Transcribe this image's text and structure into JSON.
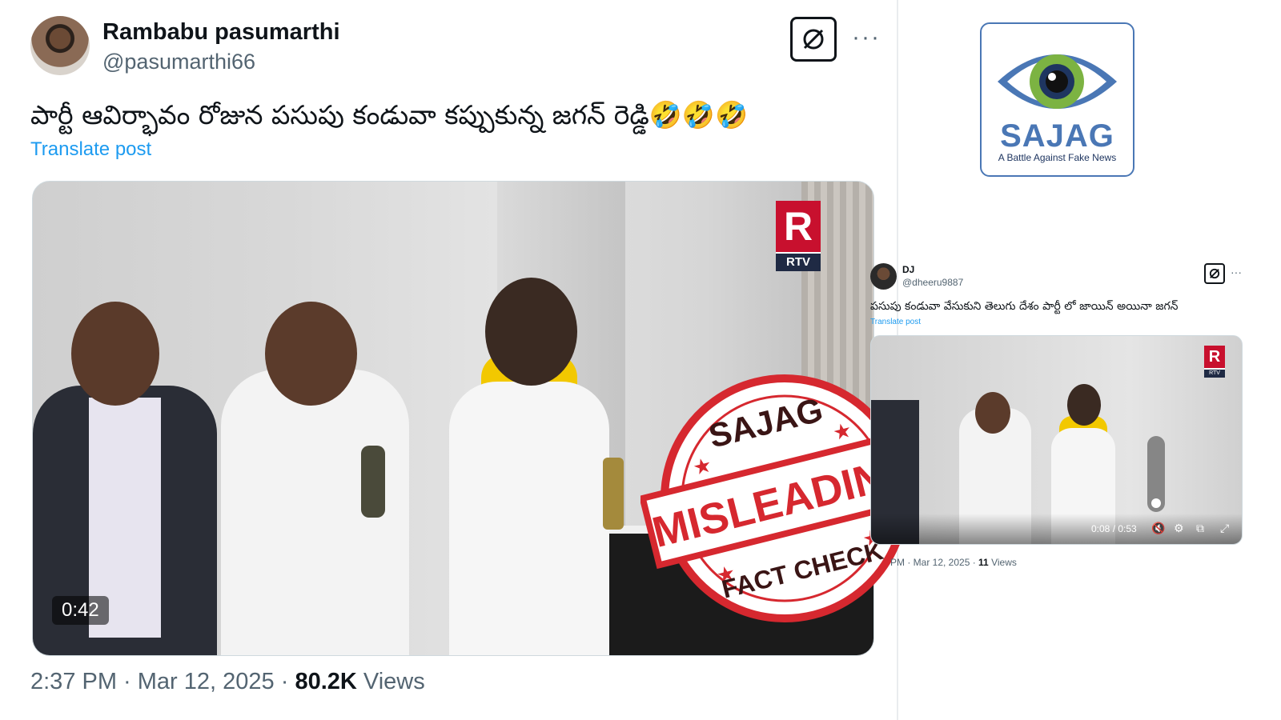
{
  "main_tweet": {
    "author_name": "Rambabu pasumarthi",
    "author_handle": "@pasumarthi66",
    "more_label": "···",
    "text": "పార్టీ ఆవిర్భావం రోజున పసుపు కండువా కప్పుకున్న జగన్ రెడ్డి🤣🤣🤣",
    "translate_label": "Translate post",
    "video": {
      "duration": "0:42",
      "channel_logo_text": "RTV",
      "channel_logo_letter": "R"
    },
    "timestamp": "2:37 PM · Mar 12, 2025 · ",
    "views_count": "80.2K",
    "views_label": " Views"
  },
  "stamp": {
    "top_text": "SAJAG",
    "middle_text": "MISLEADING",
    "bottom_text": "FACT CHECK",
    "color": "#d6282f"
  },
  "sajag_logo": {
    "name": "SAJAG",
    "tagline": "A Battle Against Fake News"
  },
  "secondary_tweet": {
    "author_name": "DJ",
    "author_handle": "@dheeru9887",
    "more_label": "···",
    "text": "పసుపు కండువా వేసుకుని తెలుగు దేశం పార్టీ లో జాయిన్ అయినా జగన్",
    "translate_label": "Translate post",
    "video": {
      "time_display": "0:08 / 0:53",
      "channel_logo_text": "RTV",
      "channel_logo_letter": "R",
      "progress_fraction": 0.15
    },
    "timestamp": "PM · Mar 12, 2025 · ",
    "views_count": "11",
    "views_label": " Views"
  },
  "colors": {
    "link_blue": "#1d9bf0",
    "muted_text": "#536471",
    "scarf_yellow": "#f2c800"
  }
}
